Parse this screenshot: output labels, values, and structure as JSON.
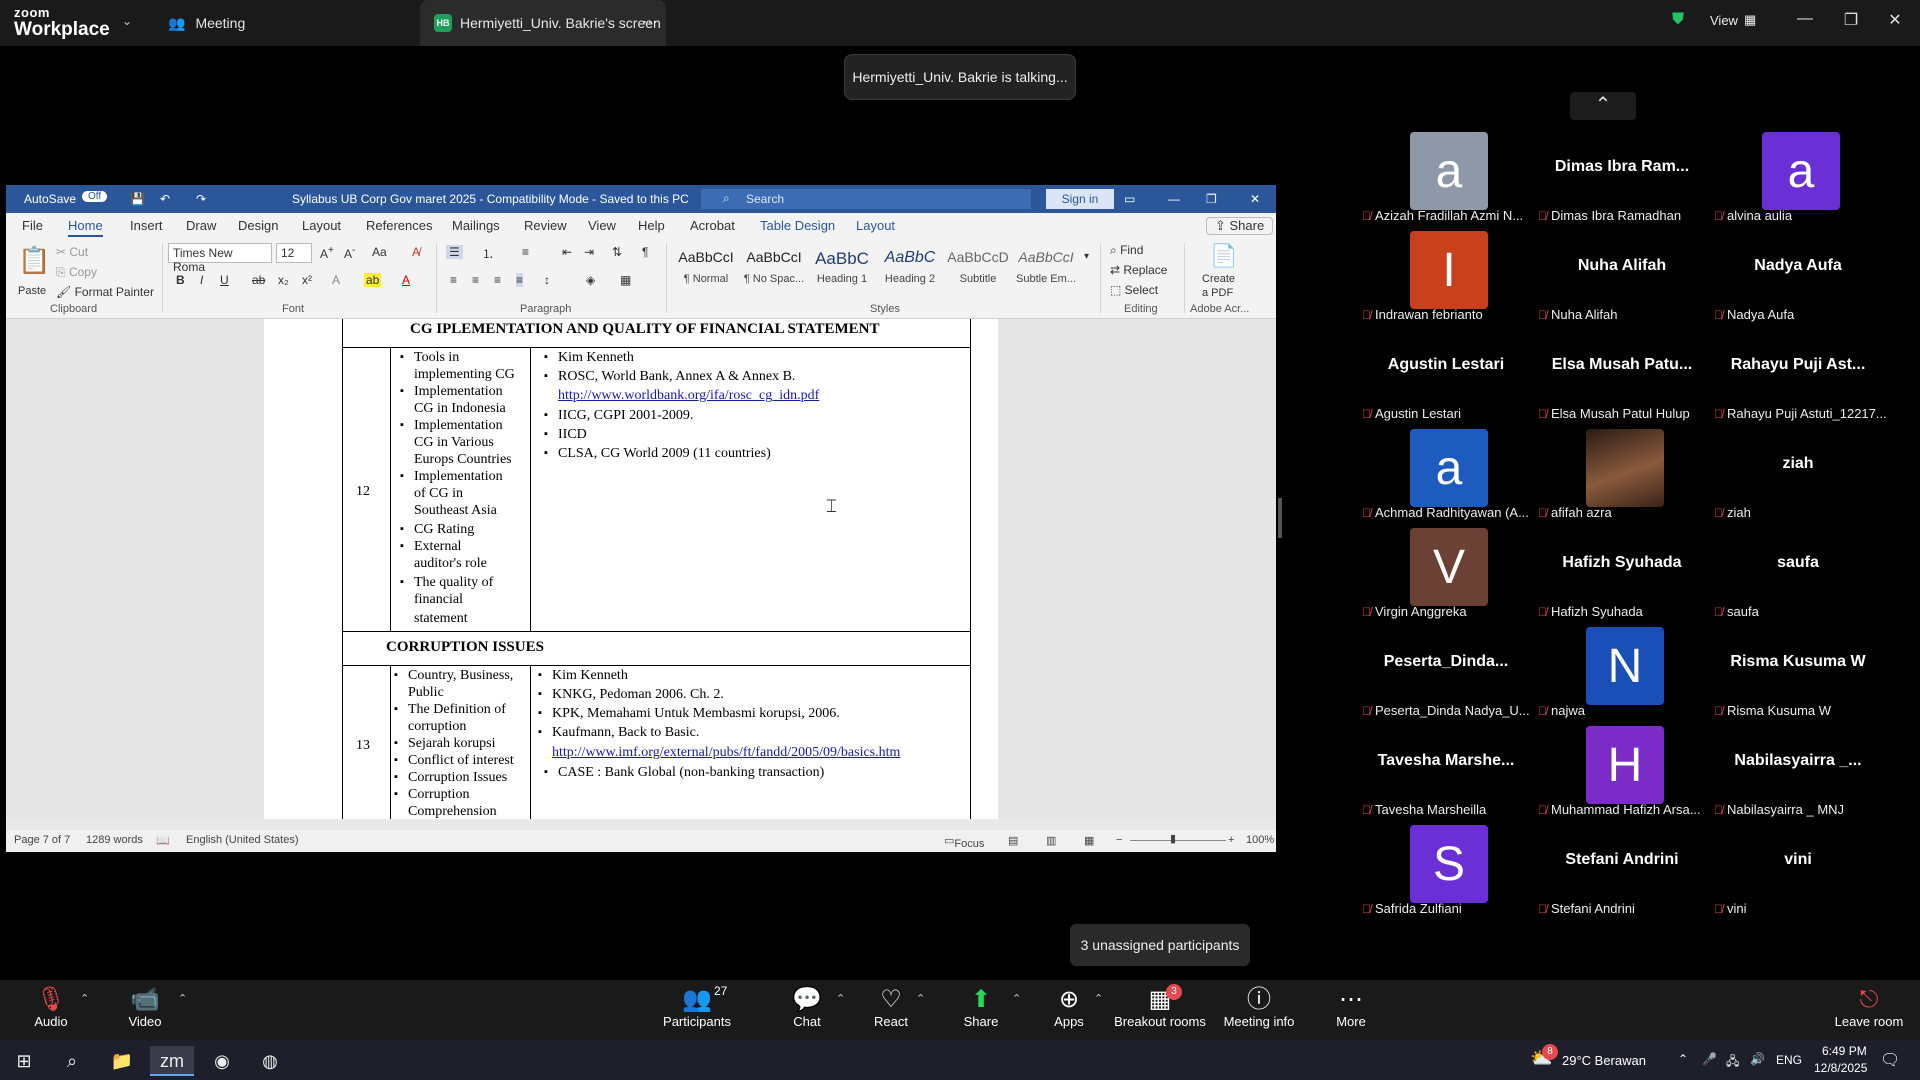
{
  "zoom": {
    "logo_top": "zoom",
    "logo_bottom": "Workplace",
    "tabs": [
      {
        "label": "Meeting"
      },
      {
        "label": "Hermiyetti_Univ. Bakrie's screen",
        "badge": "HB"
      }
    ],
    "view_label": "View",
    "talking_banner": "Hermiyetti_Univ. Bakrie is talking...",
    "unassigned_popup": "3 unassigned participants"
  },
  "word": {
    "autosave": "AutoSave",
    "autosave_state": "Off",
    "doc_title": "Syllabus UB Corp Gov maret 2025  -  Compatibility Mode  -  Saved to this PC",
    "search_placeholder": "Search",
    "sign_in": "Sign in",
    "menu": [
      "File",
      "Home",
      "Insert",
      "Draw",
      "Design",
      "Layout",
      "References",
      "Mailings",
      "Review",
      "View",
      "Help",
      "Acrobat",
      "Table Design",
      "Layout"
    ],
    "share": "Share",
    "clipboard": {
      "paste": "Paste",
      "cut": "Cut",
      "copy": "Copy",
      "format_painter": "Format Painter",
      "label": "Clipboard"
    },
    "font": {
      "name": "Times New Roma",
      "size": "12",
      "label": "Font"
    },
    "paragraph_label": "Paragraph",
    "styles": [
      {
        "sample": "AaBbCcI",
        "name": "¶ Normal"
      },
      {
        "sample": "AaBbCcI",
        "name": "¶ No Spac..."
      },
      {
        "sample": "AaBbC",
        "name": "Heading 1"
      },
      {
        "sample": "AaBbC",
        "name": "Heading 2"
      },
      {
        "sample": "AaBbCcD",
        "name": "Subtitle"
      },
      {
        "sample": "AaBbCcI",
        "name": "Subtle Em..."
      }
    ],
    "styles_label": "Styles",
    "editing": {
      "find": "Find",
      "replace": "Replace",
      "select": "Select",
      "label": "Editing"
    },
    "adobe": {
      "create_pdf_1": "Create",
      "create_pdf_2": "a PDF",
      "label": "Adobe Acr..."
    },
    "status": {
      "page": "Page 7 of 7",
      "words": "1289 words",
      "language": "English (United States)",
      "focus": "Focus",
      "zoom": "100%"
    }
  },
  "document": {
    "header_row": "CG IPLEMENTATION AND QUALITY OF FINANCIAL STATEMENT",
    "row12": {
      "num": "12",
      "topics": [
        "Tools in",
        "implementing CG",
        "Implementation",
        "CG in Indonesia",
        "Implementation",
        "CG in Various",
        "Europs Countries",
        "Implementation",
        "of  CG in",
        "Southeast Asia",
        "CG Rating",
        "External",
        "auditor's role",
        "The quality of",
        "financial",
        "statement"
      ],
      "refs": [
        "Kim Kenneth",
        "ROSC, World Bank, Annex A & Annex B.",
        "http://www.worldbank.org/ifa/rosc_cg_idn.pdf",
        "IICG, CGPI 2001-2009.",
        "IICD",
        "CLSA, CG World 2009 (11 countries)"
      ]
    },
    "section2": "CORRUPTION ISSUES",
    "row13": {
      "num": "13",
      "topics": [
        "Country, Business,",
        "Public",
        "The Definition of",
        "corruption",
        "Sejarah korupsi",
        "Conflict of interest",
        "Corruption Issues",
        "Corruption",
        "Comprehension"
      ],
      "refs": [
        "Kim Kenneth",
        "KNKG, Pedoman 2006. Ch. 2.",
        "KPK, Memahami Untuk Membasmi korupsi, 2006.",
        "Kaufmann, Back to Basic.",
        "http://www.imf.org/external/pubs/ft/fandd/2005/09/basics.htm",
        "CASE : Bank Global (non-banking transaction)"
      ]
    }
  },
  "participants": [
    {
      "big": "",
      "avatar": "a",
      "color": "#8e98a8",
      "label": "Azizah Fradillah Azmi N..."
    },
    {
      "big": "Dimas Ibra Ram...",
      "avatar": "",
      "color": "",
      "label": "Dimas Ibra Ramadhan"
    },
    {
      "big": "",
      "avatar": "a",
      "color": "#6b2fd6",
      "label": "alvina aulia"
    },
    {
      "big": "",
      "avatar": "I",
      "color": "#c8401c",
      "label": "Indrawan febrianto"
    },
    {
      "big": "Nuha Alifah",
      "avatar": "",
      "color": "",
      "label": "Nuha Alifah"
    },
    {
      "big": "Nadya Aufa",
      "avatar": "",
      "color": "",
      "label": "Nadya Aufa"
    },
    {
      "big": "Agustin Lestari",
      "avatar": "",
      "color": "",
      "label": "Agustin Lestari"
    },
    {
      "big": "Elsa Musah Patu...",
      "avatar": "",
      "color": "",
      "label": "Elsa Musah Patul Hulup"
    },
    {
      "big": "Rahayu Puji Ast...",
      "avatar": "",
      "color": "",
      "label": "Rahayu Puji Astuti_12217..."
    },
    {
      "big": "",
      "avatar": "a",
      "color": "#1e5bbf",
      "label": "Achmad Radhityawan (A..."
    },
    {
      "big": "",
      "avatar": "photo",
      "color": "#5a3b2a",
      "label": "afifah azra"
    },
    {
      "big": "ziah",
      "avatar": "",
      "color": "",
      "label": "ziah"
    },
    {
      "big": "",
      "avatar": "V",
      "color": "#6a4134",
      "label": "Virgin Anggreka"
    },
    {
      "big": "Hafizh Syuhada",
      "avatar": "",
      "color": "",
      "label": "Hafizh Syuhada"
    },
    {
      "big": "saufa",
      "avatar": "",
      "color": "",
      "label": "saufa"
    },
    {
      "big": "Peserta_Dinda...",
      "avatar": "",
      "color": "",
      "label": "Peserta_Dinda Nadya_U..."
    },
    {
      "big": "",
      "avatar": "N",
      "color": "#1a4fb8",
      "label": "najwa"
    },
    {
      "big": "Risma Kusuma W",
      "avatar": "",
      "color": "",
      "label": "Risma Kusuma W"
    },
    {
      "big": "Tavesha Marshe...",
      "avatar": "",
      "color": "",
      "label": "Tavesha Marsheilla"
    },
    {
      "big": "",
      "avatar": "H",
      "color": "#7a2bc8",
      "label": "Muhammad Hafizh Arsa..."
    },
    {
      "big": "Nabilasyairra _...",
      "avatar": "",
      "color": "",
      "label": "Nabilasyairra _ MNJ"
    },
    {
      "big": "",
      "avatar": "S",
      "color": "#6b2fd6",
      "label": "Safrida Zulfiani"
    },
    {
      "big": "Stefani Andrini",
      "avatar": "",
      "color": "",
      "label": "Stefani Andrini"
    },
    {
      "big": "vini",
      "avatar": "",
      "color": "",
      "label": "vini"
    }
  ],
  "toolbar": {
    "audio": "Audio",
    "video": "Video",
    "participants": "Participants",
    "participants_count": "27",
    "chat": "Chat",
    "react": "React",
    "share": "Share",
    "apps": "Apps",
    "breakout": "Breakout rooms",
    "breakout_badge": "3",
    "info": "Meeting info",
    "more": "More",
    "leave": "Leave room"
  },
  "taskbar": {
    "weather": "29°C  Berawan",
    "weather_badge": "8",
    "lang": "ENG",
    "time": "6:49 PM",
    "date": "12/8/2025"
  },
  "colors": {
    "word_blue": "#2b579a",
    "zoom_bg": "#000000",
    "mute_red": "#e5484d",
    "share_green": "#23d959"
  }
}
